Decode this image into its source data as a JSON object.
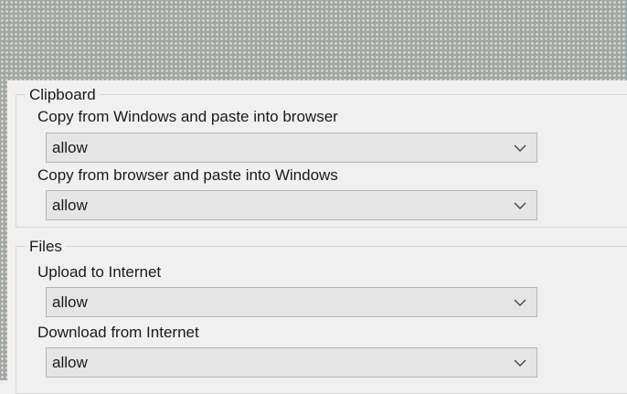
{
  "clipboard": {
    "title": "Clipboard",
    "copy_into_browser": {
      "label": "Copy from Windows and paste into browser",
      "value": "allow"
    },
    "copy_into_windows": {
      "label": "Copy from browser and paste into Windows",
      "value": "allow"
    }
  },
  "files": {
    "title": "Files",
    "upload": {
      "label": "Upload to Internet",
      "value": "allow"
    },
    "download": {
      "label": "Download from Internet",
      "value": "allow"
    }
  },
  "icons": {
    "dropdown": "chevron-down-icon"
  }
}
